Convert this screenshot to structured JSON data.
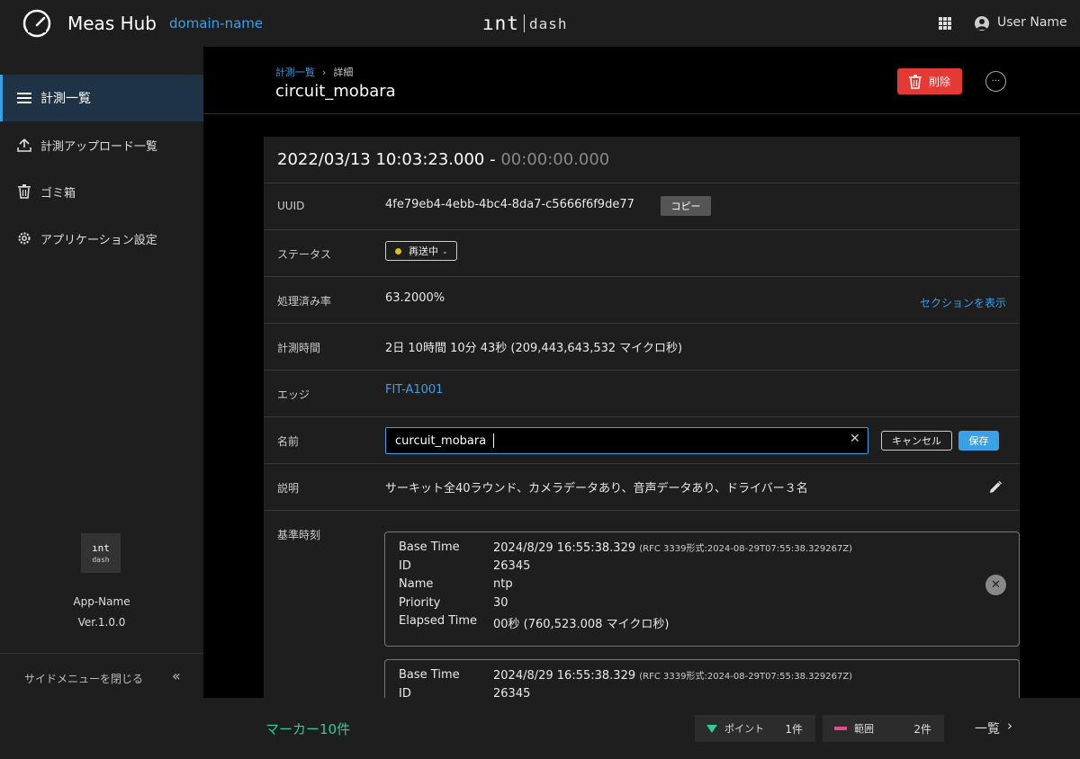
{
  "header": {
    "app_name": "Meas Hub",
    "domain": "domain-name",
    "logo_left": "ınt",
    "logo_right": "dash",
    "user_name": "User Name"
  },
  "sidebar": {
    "items": [
      {
        "label": "計測一覧",
        "icon": "list-icon",
        "active": true
      },
      {
        "label": "計測アップロード一覧",
        "icon": "upload-icon",
        "active": false
      },
      {
        "label": "ゴミ箱",
        "icon": "trash-icon",
        "active": false
      },
      {
        "label": "アプリケーション設定",
        "icon": "gear-icon",
        "active": false
      }
    ],
    "logo_top": "ınt",
    "logo_bottom": "dash",
    "app_name": "App-Name",
    "version": "Ver.1.0.0",
    "close_label": "サイドメニューを閉じる",
    "collapse_glyph": "«"
  },
  "page": {
    "breadcrumb": {
      "parent": "計測一覧",
      "separator": "›",
      "current": "詳細"
    },
    "title": "circuit_mobara",
    "delete_label": "削除",
    "more_glyph": "···"
  },
  "detail": {
    "start": "2022/03/13 10:03:23.000",
    "dash": " - ",
    "duration": "00:00:00.000",
    "rows": {
      "uuid": {
        "label": "UUID",
        "value": "4fe79eb4-4ebb-4bc4-8da7-c5666f6f9de77",
        "copy_label": "コピー"
      },
      "status": {
        "label": "ステータス",
        "value": "再送中",
        "dot_color": "#d9c214"
      },
      "processed": {
        "label": "処理済み率",
        "value": "63.2000%",
        "link": "セクションを表示"
      },
      "duration": {
        "label": "計測時間",
        "value": "2日 10時間 10分 43秒 (209,443,643,532 マイクロ秒)"
      },
      "edge": {
        "label": "エッジ",
        "value": "FIT-A1001"
      },
      "name": {
        "label": "名前",
        "input_value": "curcuit_mobara",
        "cancel_label": "キャンセル",
        "save_label": "保存"
      },
      "description": {
        "label": "説明",
        "value": "サーキット全40ラウンド、カメラデータあり、音声データあり、ドライバー３名"
      },
      "base_time": {
        "label": "基準時刻"
      }
    },
    "base_time_cards": [
      {
        "keys": [
          "Base Time",
          "ID",
          "Name",
          "Priority",
          "Elapsed Time"
        ],
        "base_time": "2024/8/29 16:55:38.329",
        "rfc": "(RFC 3339形式:2024-08-29T07:55:38.329267Z)",
        "id": "26345",
        "name": "ntp",
        "priority": "30",
        "elapsed": "00秒 (760,523.008 マイクロ秒)"
      },
      {
        "keys": [
          "Base Time",
          "ID"
        ],
        "base_time": "2024/8/29 16:55:38.329",
        "rfc": "(RFC 3339形式:2024-08-29T07:55:38.329267Z)",
        "id": "26345"
      }
    ]
  },
  "bottom": {
    "marker_count": "マーカー10件",
    "point_label": "ポイント",
    "point_count": "1件",
    "range_label": "範囲",
    "range_count": "2件",
    "list_label": "一覧",
    "list_glyph": "›"
  },
  "colors": {
    "accent": "#3aa0e8",
    "danger": "#e53935",
    "marker_green": "#2ecc9a",
    "range_pink": "#e64990",
    "status_yellow": "#d9c214"
  }
}
